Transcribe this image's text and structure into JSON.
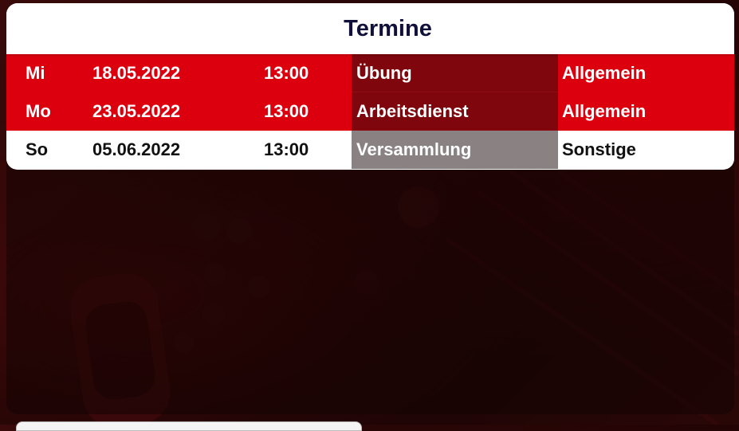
{
  "title": "Termine",
  "appointments": [
    {
      "day": "Mi",
      "date": "18.05.2022",
      "time": "13:00",
      "type": "Übung",
      "category": "Allgemein",
      "highlight": true
    },
    {
      "day": "Mo",
      "date": "23.05.2022",
      "time": "13:00",
      "type": "Arbeitsdienst",
      "category": "Allgemein",
      "highlight": true
    },
    {
      "day": "So",
      "date": "05.06.2022",
      "time": "13:00",
      "type": "Versammlung",
      "category": "Sonstige",
      "highlight": false
    }
  ],
  "colors": {
    "highlight_row": "#dc000f",
    "type_cell_highlight": "#7e060c",
    "type_cell_normal": "#8a8282",
    "title_text": "#10103a",
    "background": "#220606"
  }
}
